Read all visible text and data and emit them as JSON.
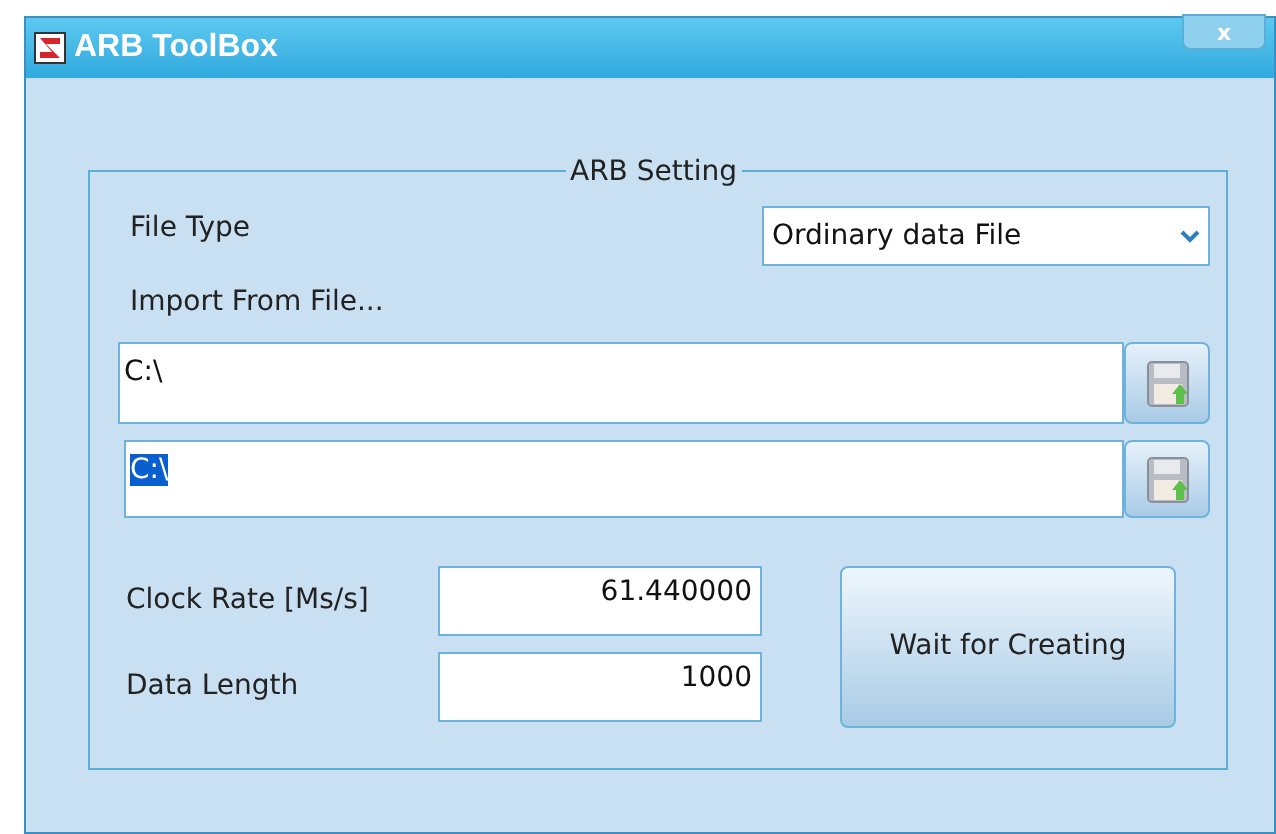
{
  "window": {
    "title": "ARB ToolBox",
    "close": "x"
  },
  "group": {
    "title": "ARB Setting"
  },
  "file_type": {
    "label": "File Type",
    "value": "Ordinary data File"
  },
  "import_label": "Import From File...",
  "paths": [
    {
      "value": "C:\\",
      "text_selected": false
    },
    {
      "value": "C:\\",
      "text_selected": true
    }
  ],
  "fields": [
    {
      "label": "Clock Rate [Ms/s]",
      "value": "61.440000"
    },
    {
      "label": "Data Length",
      "value": "1000"
    }
  ],
  "action_button": "Wait for Creating"
}
